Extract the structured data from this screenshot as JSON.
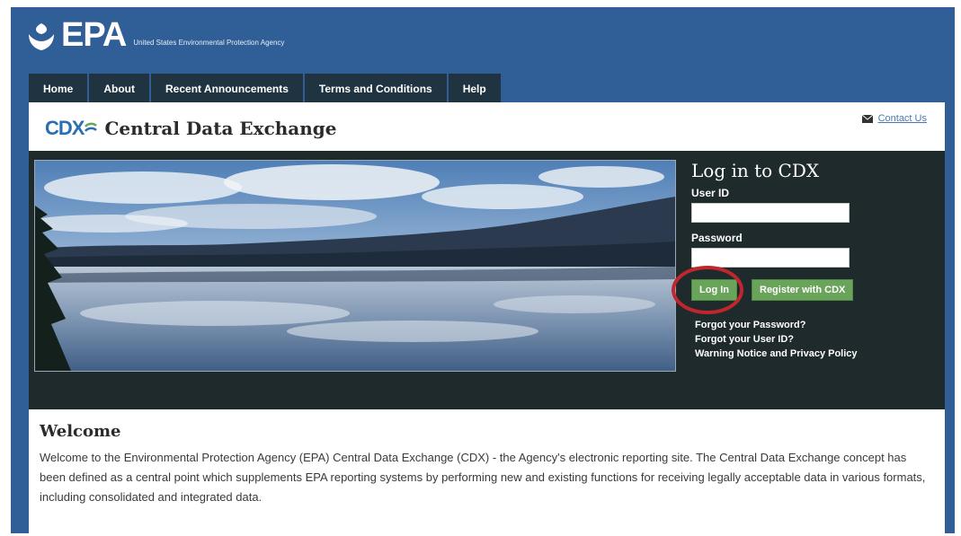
{
  "header": {
    "logo_text": "EPA",
    "agency_name": "United States Environmental Protection Agency"
  },
  "nav": {
    "items": [
      {
        "label": "Home"
      },
      {
        "label": "About"
      },
      {
        "label": "Recent Announcements"
      },
      {
        "label": "Terms and Conditions"
      },
      {
        "label": "Help"
      }
    ]
  },
  "cdx": {
    "logo_text": "CDX",
    "title": "Central Data Exchange",
    "contact_label": "Contact Us"
  },
  "login": {
    "title": "Log in to CDX",
    "user_id_label": "User ID",
    "user_id_value": "",
    "password_label": "Password",
    "password_value": "",
    "login_button": "Log In",
    "register_button": "Register with CDX",
    "forgot_password": "Forgot your Password?",
    "forgot_user_id": "Forgot your User ID?",
    "privacy_policy": "Warning Notice and Privacy Policy"
  },
  "welcome": {
    "title": "Welcome",
    "text": "Welcome to the Environmental Protection Agency (EPA) Central Data Exchange (CDX) - the Agency's electronic reporting site. The Central Data Exchange concept has been defined as a central point which supplements EPA reporting systems by performing new and existing functions for receiving legally acceptable data in various formats, including consolidated and integrated data."
  },
  "colors": {
    "header_blue": "#2f5f96",
    "nav_dark": "#1f3440",
    "band_dark": "#1f2a2c",
    "button_green": "#6aa35a",
    "annotation_red": "#c0262c",
    "cdx_blue": "#2a6fb2"
  },
  "icons": [
    "epa-logo-icon",
    "cdx-swoosh-icon",
    "mail-icon"
  ]
}
